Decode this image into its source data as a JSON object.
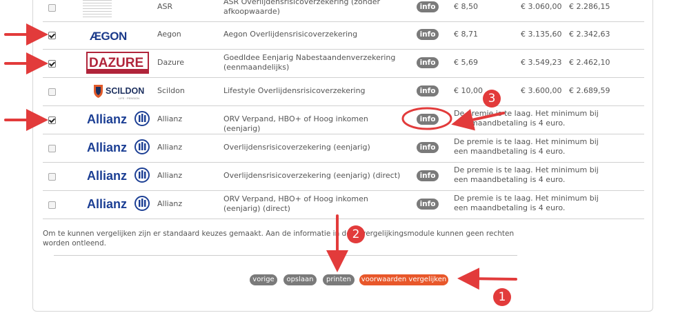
{
  "rows": [
    {
      "name": "ASR",
      "product": "ASR Overlijdensrisicoverzekering (zonder afkoopwaarde)",
      "info": "info",
      "p1": "€ 8,50",
      "p2": "€ 3.060,00",
      "p3": "€ 2.286,15",
      "checked": false
    },
    {
      "name": "Aegon",
      "product": "Aegon Overlijdensrisicoverzekering",
      "info": "info",
      "p1": "€ 8,71",
      "p2": "€ 3.135,60",
      "p3": "€ 2.342,63",
      "checked": true,
      "logo_text": "AEGON"
    },
    {
      "name": "Dazure",
      "product": "GoedIdee Eenjarig Nabestaandenverzekering (eenmaandelijks)",
      "info": "info",
      "p1": "€ 5,69",
      "p2": "€ 3.549,23",
      "p3": "€ 2.462,10",
      "checked": true,
      "logo_text": "DAZURE",
      "logo_sub": "ONTWIKKELING VAN FINANCIELE CONCEPTEN"
    },
    {
      "name": "Scildon",
      "product": "Lifestyle Overlijdensrisicoverzekering",
      "info": "info",
      "p1": "€ 10,00",
      "p2": "€ 3.600,00",
      "p3": "€ 2.689,59",
      "checked": false,
      "logo_text": "SCILDON",
      "logo_sub": "LIFE · PENSION"
    },
    {
      "name": "Allianz",
      "product": "ORV Verpand, HBO+ of Hoog inkomen (eenjarig)",
      "info": "info",
      "msg": "De premie is te laag. Het minimum bij een maandbetaling is 4 euro.",
      "checked": true,
      "logo_text": "Allianz"
    },
    {
      "name": "Allianz",
      "product": "Overlijdensrisicoverzekering (eenjarig)",
      "info": "info",
      "msg": "De premie is te laag. Het minimum bij een maandbetaling is 4 euro.",
      "checked": false,
      "logo_text": "Allianz"
    },
    {
      "name": "Allianz",
      "product": "Overlijdensrisicoverzekering (eenjarig) (direct)",
      "info": "info",
      "msg": "De premie is te laag. Het minimum bij een maandbetaling is 4 euro.",
      "checked": false,
      "logo_text": "Allianz"
    },
    {
      "name": "Allianz",
      "product": "ORV Verpand, HBO+ of Hoog inkomen (eenjarig) (direct)",
      "info": "info",
      "msg": "De premie is te laag. Het minimum bij een maandbetaling is 4 euro.",
      "checked": false,
      "logo_text": "Allianz"
    }
  ],
  "note": "Om te kunnen vergelijken zijn er standaard keuzes gemaakt. Aan de informatie in deze vergelijkingsmodule kunnen geen rechten worden ontleend.",
  "buttons": {
    "prev": "vorige",
    "save": "opslaan",
    "print": "printen",
    "compare": "voorwaarden vergelijken"
  },
  "annotations": {
    "one": "1",
    "two": "2",
    "three": "3"
  },
  "colors": {
    "accent": "#e8572a",
    "annotation": "#e23b3b",
    "info_button": "#7a7a7a",
    "allianz_blue": "#1c3f94",
    "dazure_red": "#b0243a"
  }
}
